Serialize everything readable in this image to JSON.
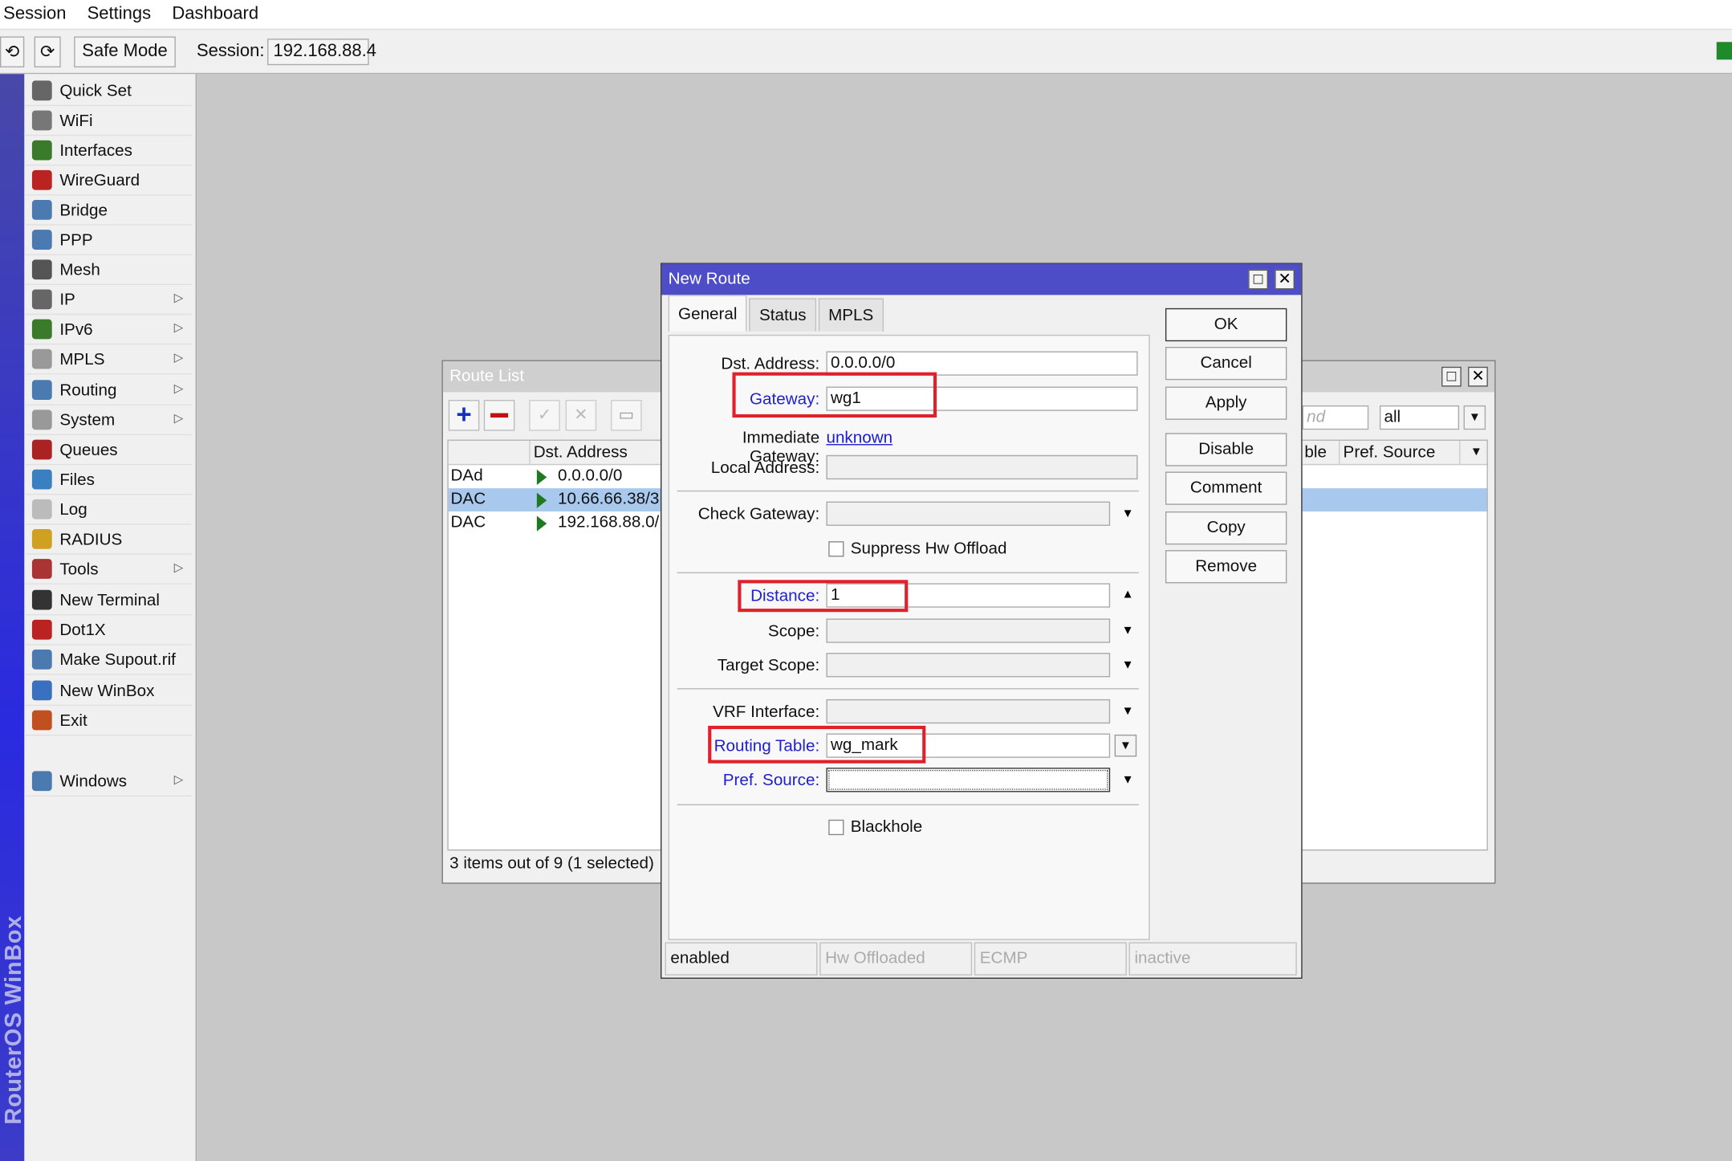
{
  "menu": [
    "Session",
    "Settings",
    "Dashboard"
  ],
  "toolbar": {
    "safe_mode": "Safe Mode",
    "session_label": "Session:",
    "session_value": "192.168.88.4"
  },
  "brand": "RouterOS WinBox",
  "sidebar": [
    {
      "label": "Quick Set",
      "icon": "wand-icon",
      "color": "#666"
    },
    {
      "label": "WiFi",
      "icon": "wifi-icon",
      "color": "#777"
    },
    {
      "label": "Interfaces",
      "icon": "interfaces-icon",
      "color": "#3a7a2a"
    },
    {
      "label": "WireGuard",
      "icon": "wireguard-icon",
      "color": "#b22"
    },
    {
      "label": "Bridge",
      "icon": "bridge-icon",
      "color": "#4a7ab0"
    },
    {
      "label": "PPP",
      "icon": "ppp-icon",
      "color": "#4a7ab0"
    },
    {
      "label": "Mesh",
      "icon": "mesh-icon",
      "color": "#555"
    },
    {
      "label": "IP",
      "icon": "ip-icon",
      "color": "#666",
      "arrow": true
    },
    {
      "label": "IPv6",
      "icon": "ipv6-icon",
      "color": "#3a7a2a",
      "arrow": true
    },
    {
      "label": "MPLS",
      "icon": "mpls-icon",
      "color": "#999",
      "arrow": true
    },
    {
      "label": "Routing",
      "icon": "routing-icon",
      "color": "#4a7ab0",
      "arrow": true
    },
    {
      "label": "System",
      "icon": "system-icon",
      "color": "#999",
      "arrow": true
    },
    {
      "label": "Queues",
      "icon": "queues-icon",
      "color": "#a22"
    },
    {
      "label": "Files",
      "icon": "folder-icon",
      "color": "#3a80c0"
    },
    {
      "label": "Log",
      "icon": "log-icon",
      "color": "#bbb"
    },
    {
      "label": "RADIUS",
      "icon": "radius-icon",
      "color": "#d0a020"
    },
    {
      "label": "Tools",
      "icon": "tools-icon",
      "color": "#a33",
      "arrow": true
    },
    {
      "label": "New Terminal",
      "icon": "terminal-icon",
      "color": "#333"
    },
    {
      "label": "Dot1X",
      "icon": "dot1x-icon",
      "color": "#b22"
    },
    {
      "label": "Make Supout.rif",
      "icon": "supout-icon",
      "color": "#4a7ab0"
    },
    {
      "label": "New WinBox",
      "icon": "winbox-icon",
      "color": "#3a70c0"
    },
    {
      "label": "Exit",
      "icon": "exit-icon",
      "color": "#c05020"
    },
    {
      "label": "Windows",
      "icon": "windows-icon",
      "color": "#4a7ab0",
      "arrow": true
    }
  ],
  "route_list": {
    "title": "Route List",
    "col_dst": "Dst. Address",
    "col_pref": "Pref. Source",
    "col_partial": "ble",
    "find_partial": "nd",
    "filter": "all",
    "rows": [
      {
        "flags": "DAd",
        "dst": "0.0.0.0/0",
        "selected": false
      },
      {
        "flags": "DAC",
        "dst": "10.66.66.38/3",
        "selected": true
      },
      {
        "flags": "DAC",
        "dst": "192.168.88.0/",
        "selected": false
      }
    ],
    "footer": "3 items out of 9 (1 selected)"
  },
  "new_route": {
    "title": "New Route",
    "tabs": [
      "General",
      "Status",
      "MPLS"
    ],
    "labels": {
      "dst": "Dst. Address:",
      "gateway": "Gateway:",
      "imm_gateway": "Immediate Gateway:",
      "local": "Local Address:",
      "check_gw": "Check Gateway:",
      "suppress": "Suppress Hw Offload",
      "distance": "Distance:",
      "scope": "Scope:",
      "target_scope": "Target Scope:",
      "vrf": "VRF Interface:",
      "routing_table": "Routing Table:",
      "pref_source": "Pref. Source:",
      "blackhole": "Blackhole"
    },
    "values": {
      "dst": "0.0.0.0/0",
      "gateway": "wg1",
      "imm_gateway": "unknown",
      "distance": "1",
      "routing_table": "wg_mark"
    },
    "buttons": [
      "OK",
      "Cancel",
      "Apply",
      "Disable",
      "Comment",
      "Copy",
      "Remove"
    ],
    "status": [
      "enabled",
      "Hw Offloaded",
      "ECMP",
      "inactive"
    ]
  },
  "colors": {
    "title_active": "#4d4dc7",
    "highlight": "#e0202a",
    "selected_row": "#a9c8ee"
  }
}
